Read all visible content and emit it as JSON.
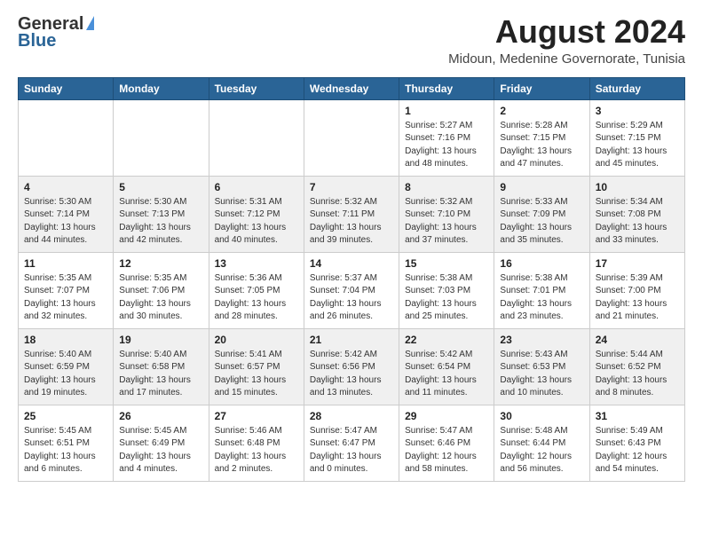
{
  "logo": {
    "line1": "General",
    "line2": "Blue"
  },
  "title": {
    "month_year": "August 2024",
    "location": "Midoun, Medenine Governorate, Tunisia"
  },
  "headers": [
    "Sunday",
    "Monday",
    "Tuesday",
    "Wednesday",
    "Thursday",
    "Friday",
    "Saturday"
  ],
  "weeks": [
    [
      {
        "day": "",
        "info": ""
      },
      {
        "day": "",
        "info": ""
      },
      {
        "day": "",
        "info": ""
      },
      {
        "day": "",
        "info": ""
      },
      {
        "day": "1",
        "info": "Sunrise: 5:27 AM\nSunset: 7:16 PM\nDaylight: 13 hours\nand 48 minutes."
      },
      {
        "day": "2",
        "info": "Sunrise: 5:28 AM\nSunset: 7:15 PM\nDaylight: 13 hours\nand 47 minutes."
      },
      {
        "day": "3",
        "info": "Sunrise: 5:29 AM\nSunset: 7:15 PM\nDaylight: 13 hours\nand 45 minutes."
      }
    ],
    [
      {
        "day": "4",
        "info": "Sunrise: 5:30 AM\nSunset: 7:14 PM\nDaylight: 13 hours\nand 44 minutes."
      },
      {
        "day": "5",
        "info": "Sunrise: 5:30 AM\nSunset: 7:13 PM\nDaylight: 13 hours\nand 42 minutes."
      },
      {
        "day": "6",
        "info": "Sunrise: 5:31 AM\nSunset: 7:12 PM\nDaylight: 13 hours\nand 40 minutes."
      },
      {
        "day": "7",
        "info": "Sunrise: 5:32 AM\nSunset: 7:11 PM\nDaylight: 13 hours\nand 39 minutes."
      },
      {
        "day": "8",
        "info": "Sunrise: 5:32 AM\nSunset: 7:10 PM\nDaylight: 13 hours\nand 37 minutes."
      },
      {
        "day": "9",
        "info": "Sunrise: 5:33 AM\nSunset: 7:09 PM\nDaylight: 13 hours\nand 35 minutes."
      },
      {
        "day": "10",
        "info": "Sunrise: 5:34 AM\nSunset: 7:08 PM\nDaylight: 13 hours\nand 33 minutes."
      }
    ],
    [
      {
        "day": "11",
        "info": "Sunrise: 5:35 AM\nSunset: 7:07 PM\nDaylight: 13 hours\nand 32 minutes."
      },
      {
        "day": "12",
        "info": "Sunrise: 5:35 AM\nSunset: 7:06 PM\nDaylight: 13 hours\nand 30 minutes."
      },
      {
        "day": "13",
        "info": "Sunrise: 5:36 AM\nSunset: 7:05 PM\nDaylight: 13 hours\nand 28 minutes."
      },
      {
        "day": "14",
        "info": "Sunrise: 5:37 AM\nSunset: 7:04 PM\nDaylight: 13 hours\nand 26 minutes."
      },
      {
        "day": "15",
        "info": "Sunrise: 5:38 AM\nSunset: 7:03 PM\nDaylight: 13 hours\nand 25 minutes."
      },
      {
        "day": "16",
        "info": "Sunrise: 5:38 AM\nSunset: 7:01 PM\nDaylight: 13 hours\nand 23 minutes."
      },
      {
        "day": "17",
        "info": "Sunrise: 5:39 AM\nSunset: 7:00 PM\nDaylight: 13 hours\nand 21 minutes."
      }
    ],
    [
      {
        "day": "18",
        "info": "Sunrise: 5:40 AM\nSunset: 6:59 PM\nDaylight: 13 hours\nand 19 minutes."
      },
      {
        "day": "19",
        "info": "Sunrise: 5:40 AM\nSunset: 6:58 PM\nDaylight: 13 hours\nand 17 minutes."
      },
      {
        "day": "20",
        "info": "Sunrise: 5:41 AM\nSunset: 6:57 PM\nDaylight: 13 hours\nand 15 minutes."
      },
      {
        "day": "21",
        "info": "Sunrise: 5:42 AM\nSunset: 6:56 PM\nDaylight: 13 hours\nand 13 minutes."
      },
      {
        "day": "22",
        "info": "Sunrise: 5:42 AM\nSunset: 6:54 PM\nDaylight: 13 hours\nand 11 minutes."
      },
      {
        "day": "23",
        "info": "Sunrise: 5:43 AM\nSunset: 6:53 PM\nDaylight: 13 hours\nand 10 minutes."
      },
      {
        "day": "24",
        "info": "Sunrise: 5:44 AM\nSunset: 6:52 PM\nDaylight: 13 hours\nand 8 minutes."
      }
    ],
    [
      {
        "day": "25",
        "info": "Sunrise: 5:45 AM\nSunset: 6:51 PM\nDaylight: 13 hours\nand 6 minutes."
      },
      {
        "day": "26",
        "info": "Sunrise: 5:45 AM\nSunset: 6:49 PM\nDaylight: 13 hours\nand 4 minutes."
      },
      {
        "day": "27",
        "info": "Sunrise: 5:46 AM\nSunset: 6:48 PM\nDaylight: 13 hours\nand 2 minutes."
      },
      {
        "day": "28",
        "info": "Sunrise: 5:47 AM\nSunset: 6:47 PM\nDaylight: 13 hours\nand 0 minutes."
      },
      {
        "day": "29",
        "info": "Sunrise: 5:47 AM\nSunset: 6:46 PM\nDaylight: 12 hours\nand 58 minutes."
      },
      {
        "day": "30",
        "info": "Sunrise: 5:48 AM\nSunset: 6:44 PM\nDaylight: 12 hours\nand 56 minutes."
      },
      {
        "day": "31",
        "info": "Sunrise: 5:49 AM\nSunset: 6:43 PM\nDaylight: 12 hours\nand 54 minutes."
      }
    ]
  ]
}
